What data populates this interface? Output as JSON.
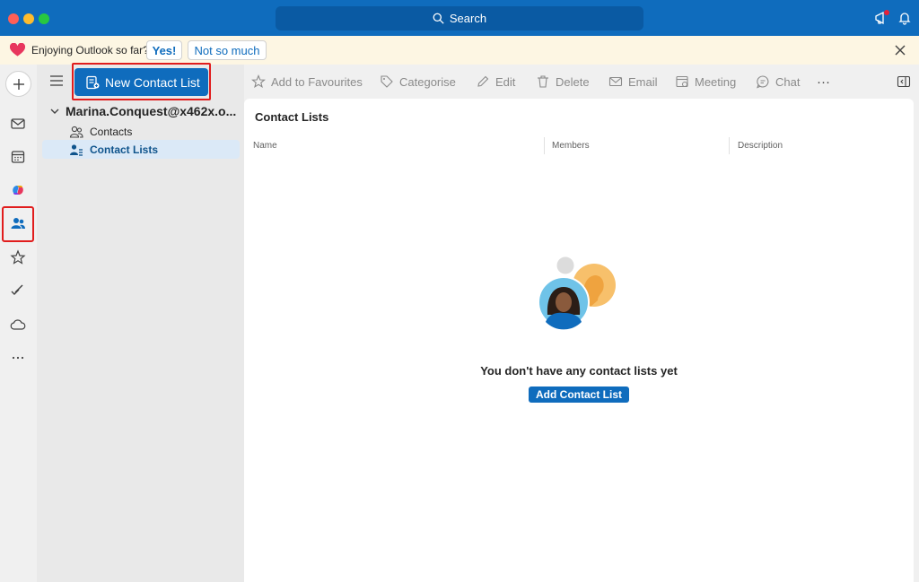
{
  "titlebar": {
    "search_label": "Search"
  },
  "banner": {
    "text": "Enjoying Outlook so far?",
    "yes_label": "Yes!",
    "no_label": "Not so much"
  },
  "folder_pane": {
    "new_list_label": "New Contact List",
    "account": "Marina.Conquest@x462x.o...",
    "items": [
      {
        "label": "Contacts",
        "icon": "contacts-icon"
      },
      {
        "label": "Contact Lists",
        "icon": "contact-list-icon",
        "selected": true
      }
    ]
  },
  "toolbar": {
    "add_to_favourites": "Add to Favourites",
    "categorise": "Categorise",
    "edit": "Edit",
    "delete": "Delete",
    "email": "Email",
    "meeting": "Meeting",
    "chat": "Chat",
    "more": "···"
  },
  "content": {
    "title": "Contact Lists",
    "columns": [
      "Name",
      "Members",
      "Description"
    ],
    "empty_message": "You don't have any contact lists yet",
    "add_button": "Add Contact List"
  },
  "colors": {
    "accent": "#0f6cbd",
    "highlight_outline": "#e11d1d",
    "banner_bg": "#fdf6e3"
  }
}
